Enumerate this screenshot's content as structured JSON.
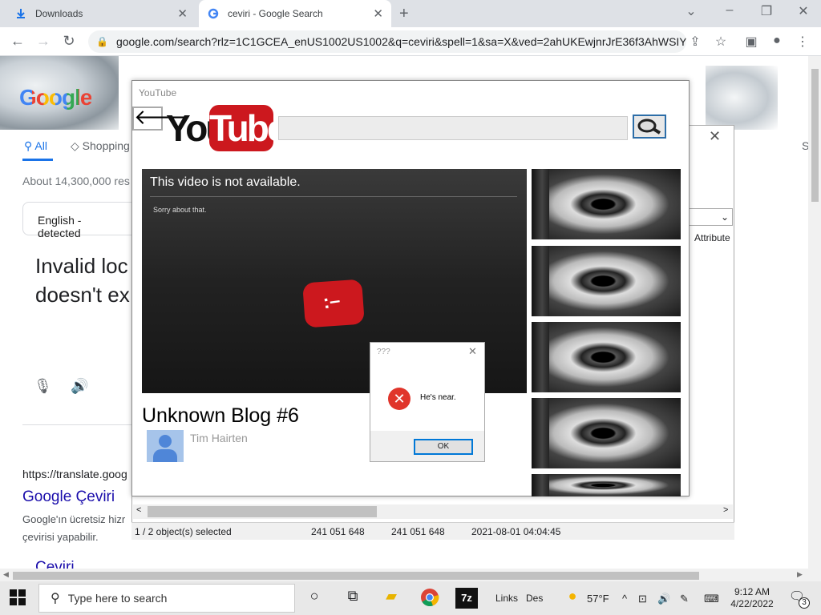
{
  "browser": {
    "tabs": [
      {
        "label": "Downloads",
        "icon": "download-icon",
        "active": false
      },
      {
        "label": "ceviri - Google Search",
        "icon": "google-g-icon",
        "active": true
      }
    ],
    "url": "google.com/search?rlz=1C1GCEA_enUS1002US1002&q=ceviri&spell=1&sa=X&ved=2ahUKEwjnrJrE36f3AhWSIY..."
  },
  "google": {
    "logo": "Google",
    "tabs": {
      "all": "All",
      "shopping": "Shopping"
    },
    "result_stats": "About 14,300,000 res",
    "detected": "English - detected",
    "invalid_text": "Invalid loc doesn't ex",
    "result_url": "https://translate.goog",
    "result_title": "Google Çeviri",
    "result_snippet": "Google'ın ücretsiz hizr çevirisi yapabilir.",
    "next_result": "Çeviri",
    "right_letter": "S"
  },
  "zip": {
    "attribute_header": "Attribute",
    "status": {
      "selection": "1 / 2 object(s) selected",
      "size": "241 051 648",
      "packed": "241 051 648",
      "date": "2021-08-01 04:04:45"
    }
  },
  "youtube": {
    "window_title": "YouTube",
    "logo_you": "You",
    "logo_tube": "Tube",
    "back_arrow": "🡐",
    "player": {
      "error_title": "This video is not  available.",
      "error_sub": "Sorry about that."
    },
    "dialog": {
      "title": "???",
      "message": "He's near.",
      "ok_label": "OK"
    },
    "blog_title": "Unknown Blog #6",
    "author": "Tim Hairten"
  },
  "taskbar": {
    "search_placeholder": "Type here to search",
    "links": "Links",
    "des": "Des",
    "weather": "57°F",
    "time": "9:12 AM",
    "date": "4/22/2022",
    "notification_count": "3"
  }
}
